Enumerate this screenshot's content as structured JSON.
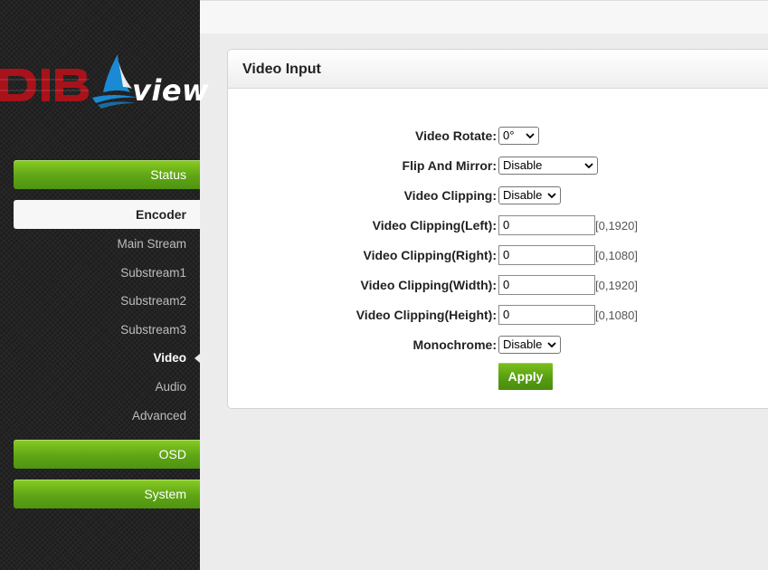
{
  "logo": {
    "brand": "DIB",
    "suffix": "view"
  },
  "nav": {
    "status": "Status",
    "encoder": "Encoder",
    "encoder_items": [
      "Main Stream",
      "Substream1",
      "Substream2",
      "Substream3",
      "Video",
      "Audio",
      "Advanced"
    ],
    "current_item": "Video",
    "osd": "OSD",
    "system": "System"
  },
  "panel": {
    "title": "Video Input",
    "rotate": {
      "label": "Video Rotate:",
      "value": "0°"
    },
    "flip": {
      "label": "Flip And Mirror:",
      "value": "Disable"
    },
    "clipping": {
      "label": "Video Clipping:",
      "value": "Disable"
    },
    "clip_left": {
      "label": "Video Clipping(Left):",
      "value": "0",
      "range": "[0,1920]"
    },
    "clip_right": {
      "label": "Video Clipping(Right):",
      "value": "0",
      "range": "[0,1080]"
    },
    "clip_width": {
      "label": "Video Clipping(Width):",
      "value": "0",
      "range": "[0,1920]"
    },
    "clip_height": {
      "label": "Video Clipping(Height):",
      "value": "0",
      "range": "[0,1080]"
    },
    "monochrome": {
      "label": "Monochrome:",
      "value": "Disable"
    },
    "apply": "Apply"
  },
  "colors": {
    "accent_green": "#5fa516",
    "logo_red": "#b1121b",
    "logo_blue": "#1a8ad4"
  }
}
